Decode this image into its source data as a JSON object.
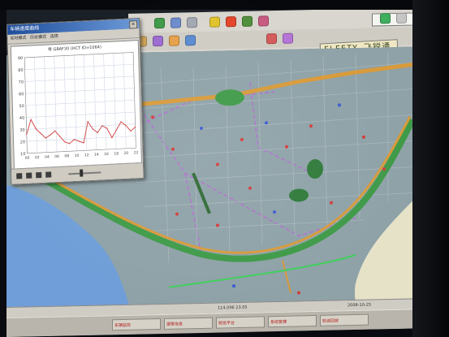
{
  "chart_window": {
    "title": "车辆速度曲线",
    "menu": [
      "实时模式",
      "历史模式",
      "选项"
    ],
    "plot_caption": "粤 G8AF30 (HCT ID=1064)",
    "y_ticks": [
      "90",
      "80",
      "70",
      "60",
      "50",
      "40",
      "30",
      "20",
      "10"
    ],
    "x_ticks": [
      "00",
      "02",
      "04",
      "06",
      "08",
      "10",
      "12",
      "14",
      "16",
      "18",
      "20",
      "22"
    ],
    "close_glyph": "×"
  },
  "chart_data": {
    "type": "line",
    "title": "粤 G8AF30 (HCT ID=1064)",
    "ylim": [
      0,
      100
    ],
    "xlim": [
      0,
      23
    ],
    "grid": true,
    "x": [
      0,
      1,
      2,
      3,
      4,
      5,
      6,
      7,
      8,
      9,
      10,
      11,
      12,
      13,
      14,
      15,
      16,
      17,
      18,
      19,
      20,
      21,
      22,
      23
    ],
    "series": [
      {
        "values": [
          20,
          35,
          25,
          20,
          15,
          18,
          22,
          16,
          10,
          8,
          12,
          10,
          8,
          30,
          22,
          18,
          25,
          22,
          12,
          20,
          28,
          24,
          18,
          22
        ]
      }
    ]
  },
  "toolbar": {
    "brand": "FLEETY 飞锐通讯",
    "icons": [
      "open-icon",
      "save-icon",
      "print-icon",
      "zoom-in-icon",
      "zoom-out-icon",
      "pan-icon",
      "locate-icon",
      "car-icon",
      "route-icon",
      "measure-icon"
    ]
  },
  "status": {
    "left": "114.096 23.05",
    "right": "2008-10-25"
  },
  "taskbar": {
    "items": [
      "车辆监控",
      "报警信息",
      "短信平台",
      "系统管理",
      "轨迹回放"
    ]
  },
  "colors": {
    "map_background": "#8ea2a8",
    "water": "#6f9ed8",
    "main_road": "#d89a3a",
    "green_road": "#3f9a48",
    "district_border": "#b56ad3"
  }
}
